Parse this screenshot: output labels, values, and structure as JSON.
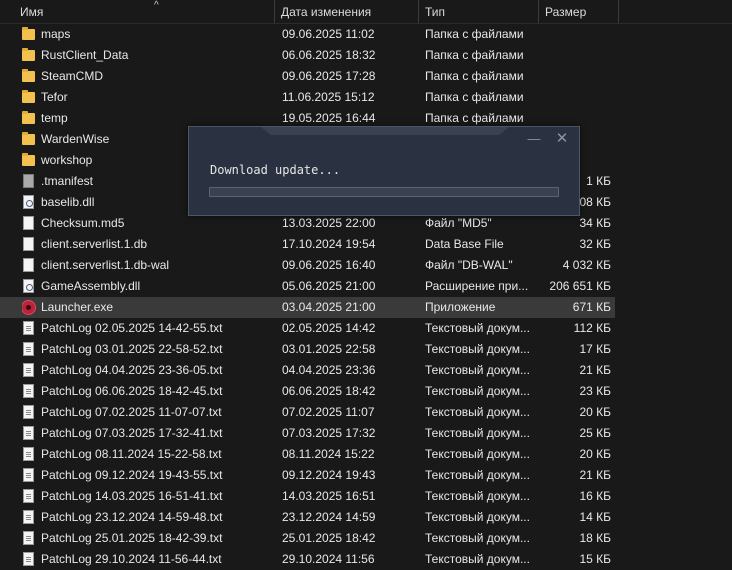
{
  "columns": {
    "name": "Имя",
    "date": "Дата изменения",
    "type": "Тип",
    "size": "Размер"
  },
  "files": [
    {
      "name": "maps",
      "date": "09.06.2025 11:02",
      "type": "Папка с файлами",
      "size": "",
      "icon": "folder-icon"
    },
    {
      "name": "RustClient_Data",
      "date": "06.06.2025 18:32",
      "type": "Папка с файлами",
      "size": "",
      "icon": "folder-icon"
    },
    {
      "name": "SteamCMD",
      "date": "09.06.2025 17:28",
      "type": "Папка с файлами",
      "size": "",
      "icon": "folder-icon"
    },
    {
      "name": "Tefor",
      "date": "11.06.2025 15:12",
      "type": "Папка с файлами",
      "size": "",
      "icon": "folder-icon"
    },
    {
      "name": "temp",
      "date": "19.05.2025 16:44",
      "type": "Папка с файлами",
      "size": "",
      "icon": "folder-icon"
    },
    {
      "name": "WardenWise",
      "date": "",
      "type": "",
      "size": "",
      "icon": "folder-icon"
    },
    {
      "name": "workshop",
      "date": "",
      "type": "",
      "size": "",
      "icon": "folder-icon"
    },
    {
      "name": ".tmanifest",
      "date": "",
      "type": "",
      "size": "1 КБ",
      "icon": "file-grey-icon"
    },
    {
      "name": "baselib.dll",
      "date": "",
      "type": "",
      "size": "408 КБ",
      "icon": "dll-icon"
    },
    {
      "name": "Checksum.md5",
      "date": "13.03.2025 22:00",
      "type": "Файл \"MD5\"",
      "size": "34 КБ",
      "icon": "file-icon"
    },
    {
      "name": "client.serverlist.1.db",
      "date": "17.10.2024 19:54",
      "type": "Data Base File",
      "size": "32 КБ",
      "icon": "file-icon"
    },
    {
      "name": "client.serverlist.1.db-wal",
      "date": "09.06.2025 16:40",
      "type": "Файл \"DB-WAL\"",
      "size": "4 032 КБ",
      "icon": "file-icon"
    },
    {
      "name": "GameAssembly.dll",
      "date": "05.06.2025 21:00",
      "type": "Расширение при...",
      "size": "206 651 КБ",
      "icon": "dll-icon"
    },
    {
      "name": "Launcher.exe",
      "date": "03.04.2025 21:00",
      "type": "Приложение",
      "size": "671 КБ",
      "icon": "app-icon",
      "selected": true
    },
    {
      "name": "PatchLog 02.05.2025 14-42-55.txt",
      "date": "02.05.2025 14:42",
      "type": "Текстовый докум...",
      "size": "112 КБ",
      "icon": "txt-icon"
    },
    {
      "name": "PatchLog 03.01.2025 22-58-52.txt",
      "date": "03.01.2025 22:58",
      "type": "Текстовый докум...",
      "size": "17 КБ",
      "icon": "txt-icon"
    },
    {
      "name": "PatchLog 04.04.2025 23-36-05.txt",
      "date": "04.04.2025 23:36",
      "type": "Текстовый докум...",
      "size": "21 КБ",
      "icon": "txt-icon"
    },
    {
      "name": "PatchLog 06.06.2025 18-42-45.txt",
      "date": "06.06.2025 18:42",
      "type": "Текстовый докум...",
      "size": "23 КБ",
      "icon": "txt-icon"
    },
    {
      "name": "PatchLog 07.02.2025 11-07-07.txt",
      "date": "07.02.2025 11:07",
      "type": "Текстовый докум...",
      "size": "20 КБ",
      "icon": "txt-icon"
    },
    {
      "name": "PatchLog 07.03.2025 17-32-41.txt",
      "date": "07.03.2025 17:32",
      "type": "Текстовый докум...",
      "size": "25 КБ",
      "icon": "txt-icon"
    },
    {
      "name": "PatchLog 08.11.2024 15-22-58.txt",
      "date": "08.11.2024 15:22",
      "type": "Текстовый докум...",
      "size": "20 КБ",
      "icon": "txt-icon"
    },
    {
      "name": "PatchLog 09.12.2024 19-43-55.txt",
      "date": "09.12.2024 19:43",
      "type": "Текстовый докум...",
      "size": "21 КБ",
      "icon": "txt-icon"
    },
    {
      "name": "PatchLog 14.03.2025 16-51-41.txt",
      "date": "14.03.2025 16:51",
      "type": "Текстовый докум...",
      "size": "16 КБ",
      "icon": "txt-icon"
    },
    {
      "name": "PatchLog 23.12.2024 14-59-48.txt",
      "date": "23.12.2024 14:59",
      "type": "Текстовый докум...",
      "size": "14 КБ",
      "icon": "txt-icon"
    },
    {
      "name": "PatchLog 25.01.2025 18-42-39.txt",
      "date": "25.01.2025 18:42",
      "type": "Текстовый докум...",
      "size": "18 КБ",
      "icon": "txt-icon"
    },
    {
      "name": "PatchLog 29.10.2024 11-56-44.txt",
      "date": "29.10.2024 11:56",
      "type": "Текстовый докум...",
      "size": "15 КБ",
      "icon": "txt-icon"
    }
  ],
  "popup": {
    "message": "Download update...",
    "progress": 0,
    "minimize_glyph": "—",
    "close_glyph": "✕"
  },
  "sort_glyph": "^"
}
